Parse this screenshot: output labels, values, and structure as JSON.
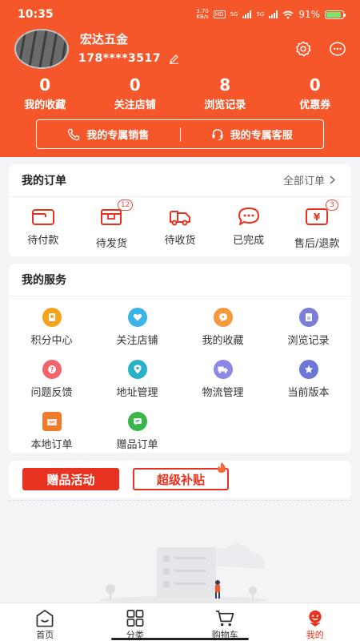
{
  "status_bar": {
    "time": "10:35",
    "net_speed": "3.70",
    "net_unit": "KB/s",
    "hd_tag": "HD",
    "signal_1": "5G",
    "signal_2": "5G",
    "battery": "91%",
    "battery_level": 0.91
  },
  "profile": {
    "shop_name": "宏达五金",
    "phone": "178****3517"
  },
  "stats": [
    {
      "value": "0",
      "label": "我的收藏"
    },
    {
      "value": "0",
      "label": "关注店铺"
    },
    {
      "value": "8",
      "label": "浏览记录"
    },
    {
      "value": "0",
      "label": "优惠券"
    }
  ],
  "contacts": {
    "sales": "我的专属销售",
    "service": "我的专属客服"
  },
  "orders": {
    "title": "我的订单",
    "all_link": "全部订单",
    "items": [
      {
        "label": "待付款",
        "badge": null
      },
      {
        "label": "待发货",
        "badge": "12"
      },
      {
        "label": "待收货",
        "badge": null
      },
      {
        "label": "已完成",
        "badge": null
      },
      {
        "label": "售后/退款",
        "badge": "3"
      }
    ]
  },
  "services": {
    "title": "我的服务",
    "items": [
      {
        "label": "积分中心",
        "icon": "points-icon",
        "color": "#f6a31b"
      },
      {
        "label": "关注店铺",
        "icon": "heart-icon",
        "color": "#3bb3e6"
      },
      {
        "label": "我的收藏",
        "icon": "star-chat-icon",
        "color": "#f59a3a"
      },
      {
        "label": "浏览记录",
        "icon": "document-icon",
        "color": "#7b7fd9"
      },
      {
        "label": "问题反馈",
        "icon": "question-icon",
        "color": "#f2646b"
      },
      {
        "label": "地址管理",
        "icon": "location-icon",
        "color": "#29b0c9"
      },
      {
        "label": "物流管理",
        "icon": "truck-icon",
        "color": "#8d87e8"
      },
      {
        "label": "当前版本",
        "icon": "star-icon",
        "color": "#6c76d6"
      },
      {
        "label": "本地订单",
        "icon": "box-icon",
        "color": "#f07a2a"
      },
      {
        "label": "赠品订单",
        "icon": "message-icon",
        "color": "#39b54a"
      }
    ]
  },
  "promos": {
    "gift": "赠品活动",
    "subsidy": "超级补贴"
  },
  "bottom_nav": [
    {
      "label": "首页",
      "icon": "home-face-icon"
    },
    {
      "label": "分类",
      "icon": "grid-icon"
    },
    {
      "label": "购物车",
      "icon": "cart-icon"
    },
    {
      "label": "我的",
      "icon": "mine-icon",
      "active": true
    }
  ],
  "colors": {
    "brand": "#f5562a",
    "accent_red": "#e8321f",
    "nav_active": "#e5331f"
  }
}
